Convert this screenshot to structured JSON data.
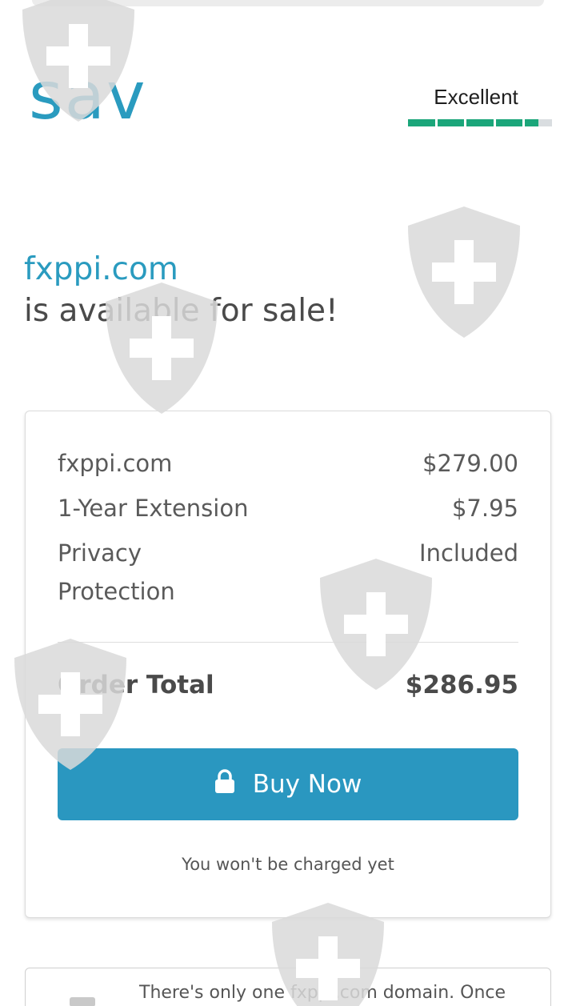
{
  "header": {
    "logo": "sav",
    "rating": {
      "label": "Excellent",
      "score_fraction": 0.9,
      "color": "#1ba67a"
    }
  },
  "headline": {
    "domain": "fxppi.com",
    "subtitle": "is available for sale!"
  },
  "order": {
    "items": [
      {
        "label": "fxppi.com",
        "value": "$279.00"
      },
      {
        "label": "1-Year Extension",
        "value": "$7.95"
      },
      {
        "label_line1": "Privacy",
        "label_line2": "Protection",
        "value": "Included"
      }
    ],
    "total_label": "Order Total",
    "total_value": "$286.95",
    "buy_label": "Buy Now",
    "note": "You won't be charged yet"
  },
  "info": {
    "text": "There's only one fxppi.com domain. Once"
  },
  "colors": {
    "brand": "#2a9bbf",
    "button": "#2a97c0",
    "watermark": "#d9d9d9"
  },
  "icons": [
    "lock-icon",
    "shield-plus-icon"
  ]
}
